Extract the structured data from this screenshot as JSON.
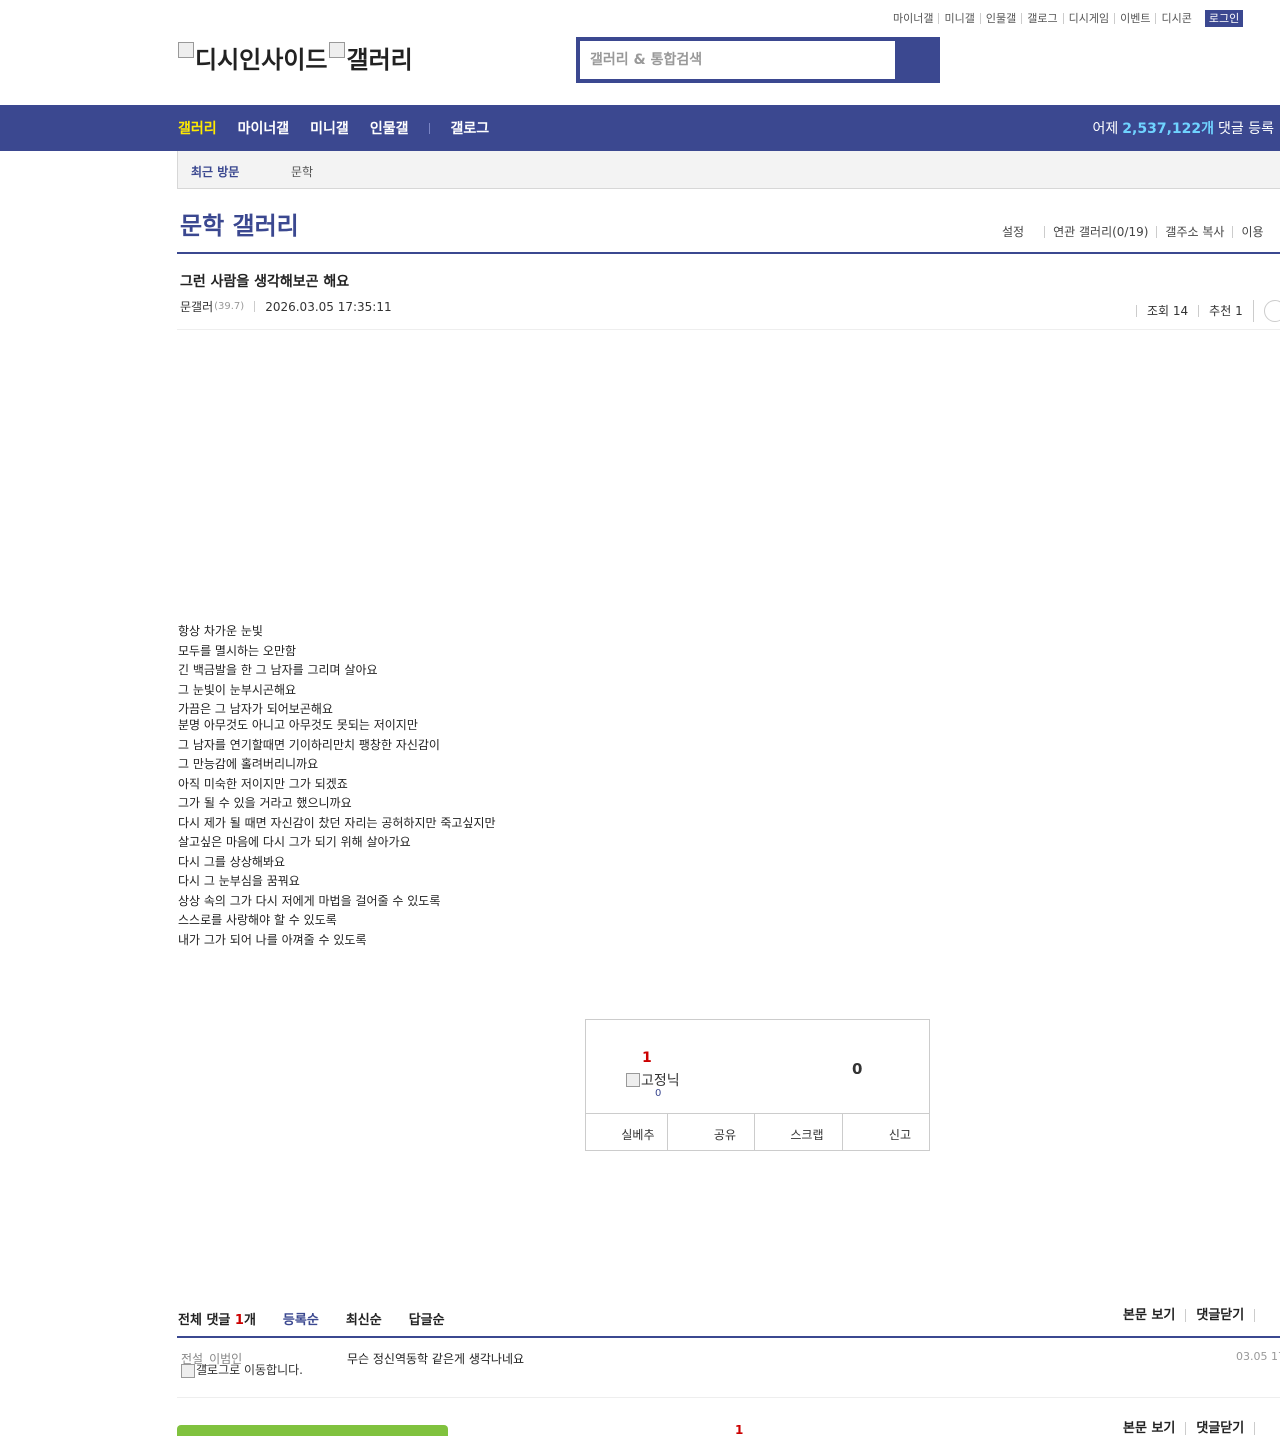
{
  "top_links": [
    "마이너갤",
    "미니갤",
    "인물갤",
    "갤로그",
    "디시게임",
    "이벤트",
    "디시콘"
  ],
  "login_label": "로그인",
  "logo": {
    "alt_left": "디시인사이드",
    "alt_right": "갤러리"
  },
  "search": {
    "placeholder": "갤러리 & 통합검색",
    "value": ""
  },
  "nav": {
    "items": [
      "갤러리",
      "마이너갤",
      "미니갤",
      "인물갤"
    ],
    "gallog": "갤로그",
    "stat_prefix": "어제",
    "stat_num": "2,537,122개",
    "stat_suffix": "댓글 등록"
  },
  "recent": {
    "label": "최근 방문",
    "item": "문학"
  },
  "gallery": {
    "title": "문학 갤러리",
    "tools": [
      "설정",
      "연관 갤러리(0/19)",
      "갤주소 복사",
      "이용"
    ]
  },
  "post": {
    "title": "그런 사람을 생각해보곤 해요",
    "author": "문갤러",
    "ip": "(39.7)",
    "date": "2026.03.05 17:35:11",
    "views": "조회 14",
    "recommends": "추천 1",
    "lines": [
      "항상 차가운 눈빛",
      "모두를 멸시하는 오만함",
      "긴 백금발을 한 그 남자를 그리며 살아요",
      "그 눈빛이 눈부시곤해요",
      "가끔은 그 남자가 되어보곤해요",
      "분명 아무것도 아니고 아무것도 못되는 저이지만",
      "그 남자를 연기할때면 기이하리만치 팽창한 자신감이",
      "그 만능감에 홀려버리니까요",
      "아직 미숙한 저이지만 그가 되겠죠",
      "그가 될 수 있을 거라고 했으니까요",
      "다시 제가 될 때면 자신감이 찼던 자리는 공허하지만 죽고싶지만",
      "살고싶은 마음에 다시 그가 되기 위해 살아가요",
      "다시 그를 상상해봐요",
      "다시 그 눈부심을 꿈꿔요",
      "상상 속의 그가 다시 저에게 마법을 걸어줄 수 있도록",
      "스스로를 사랑해야 할 수 있도록",
      "내가 그가 되어 나를 아껴줄 수 있도록"
    ]
  },
  "recommend": {
    "up": "1",
    "fixed_alt": "고정닉",
    "fixed_count": "0",
    "down": "0",
    "buttons": [
      "실베추",
      "공유",
      "스크랩",
      "신고"
    ]
  },
  "comments": {
    "total_label": "전체 댓글",
    "total_count": "1",
    "total_unit": "개",
    "sort_tabs": [
      "등록순",
      "최신순",
      "답글순"
    ],
    "right_links": [
      "본문 보기",
      "댓글닫기"
    ],
    "items": [
      {
        "author": "전설_이범인",
        "gallog_alt": "갤로그로 이동합니다.",
        "text": "무슨 정신역동학 같은게 생각나네요",
        "date": "03.05 17"
      }
    ],
    "page": "1"
  },
  "colors": {
    "brand_navy": "#3b4890",
    "highlight_yellow": "#ffea00",
    "stat_cyan": "#6fd3ff",
    "recommend_red": "#cc0000",
    "write_green": "#80c23e"
  }
}
